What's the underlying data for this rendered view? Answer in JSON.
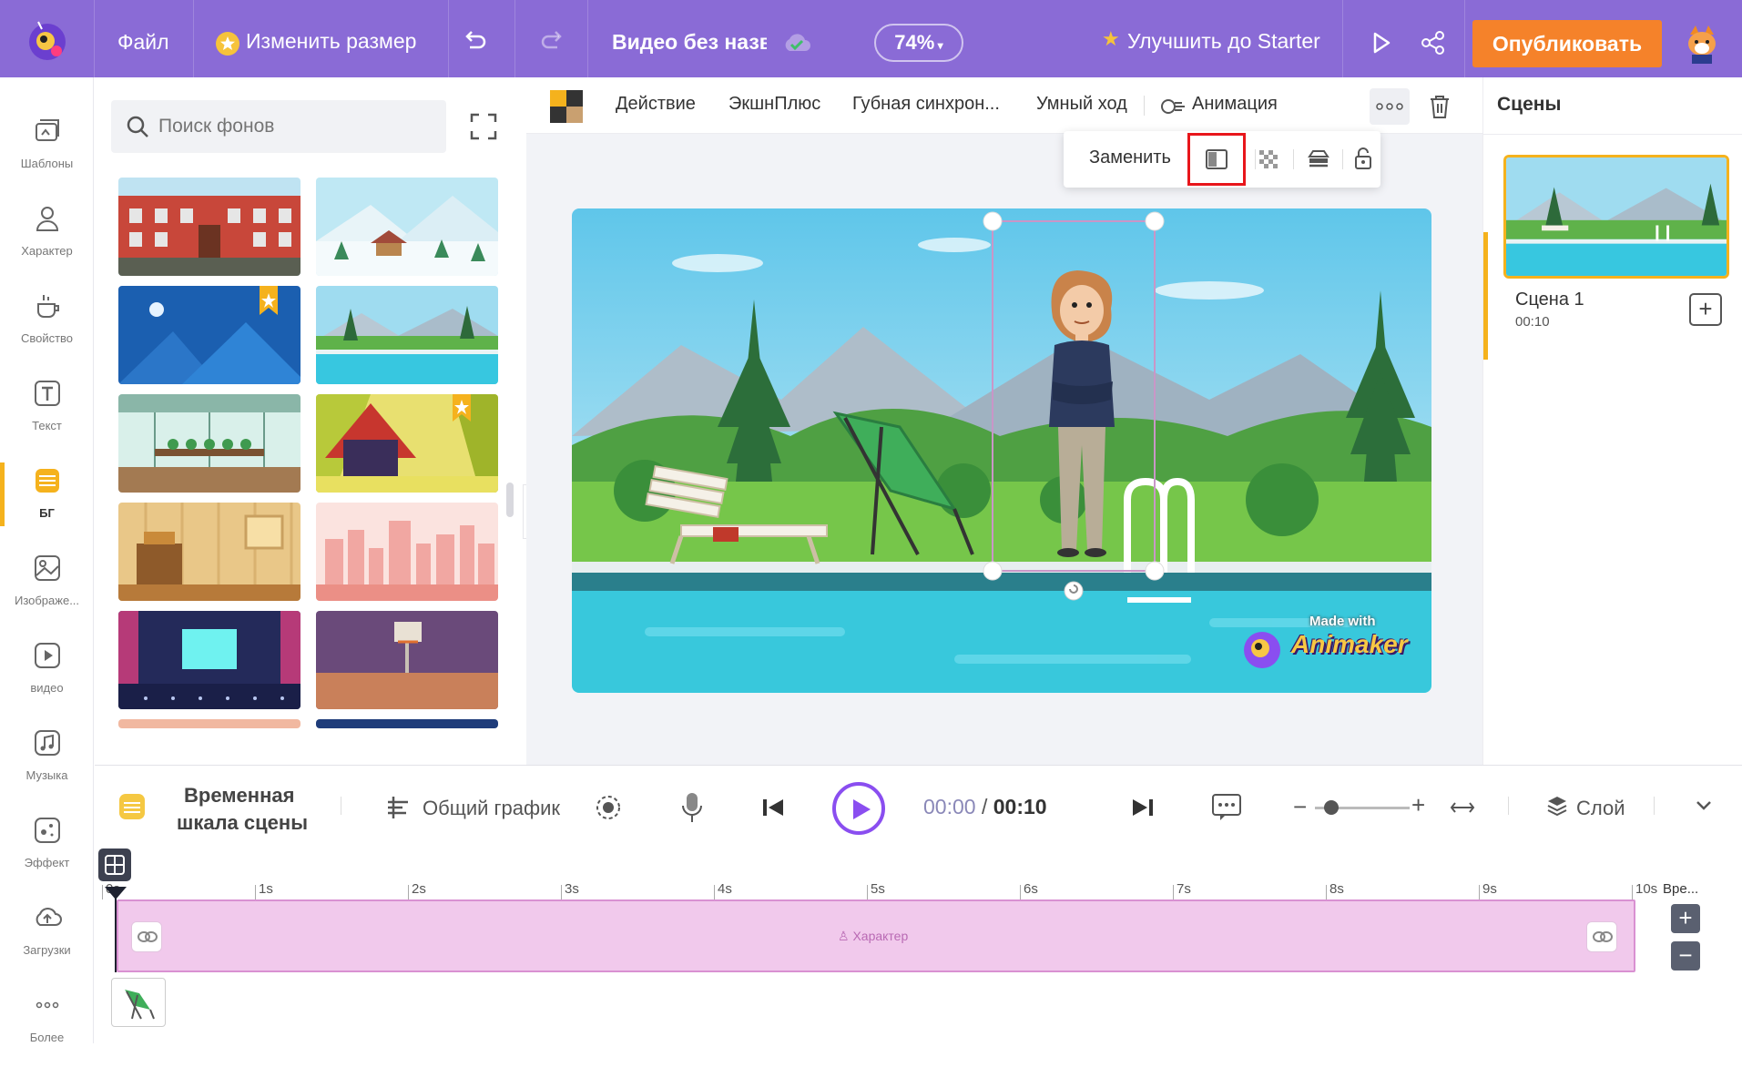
{
  "topbar": {
    "file_menu": "Файл",
    "resize_label": "Изменить размер",
    "video_title": "Видео без назв",
    "zoom": "74%",
    "upgrade_label": "Улучшить до Starter",
    "publish_label": "Опубликовать"
  },
  "rail": {
    "items": [
      {
        "label": "Шаблоны",
        "icon": "templates-icon"
      },
      {
        "label": "Характер",
        "icon": "character-icon"
      },
      {
        "label": "Свойство",
        "icon": "props-icon"
      },
      {
        "label": "Текст",
        "icon": "text-icon"
      },
      {
        "label": "БГ",
        "icon": "background-icon"
      },
      {
        "label": "Изображе...",
        "icon": "image-icon"
      },
      {
        "label": "видео",
        "icon": "video-icon"
      },
      {
        "label": "Музыка",
        "icon": "music-icon"
      },
      {
        "label": "Эффект",
        "icon": "effect-icon"
      },
      {
        "label": "Загрузки",
        "icon": "upload-icon"
      },
      {
        "label": "Более",
        "icon": "more-icon"
      }
    ]
  },
  "library": {
    "search_placeholder": "Поиск фонов"
  },
  "actbar": {
    "action": "Действие",
    "actionplus": "ЭкшнПлюс",
    "lipsync": "Губная синхрон...",
    "smart_move": "Умный ход",
    "animation": "Анимация"
  },
  "popup": {
    "replace": "Заменить"
  },
  "scene": {
    "watermark_top": "Made with",
    "watermark_brand": "Animaker"
  },
  "scenes_panel": {
    "title": "Сцены",
    "scene_name": "Сцена 1",
    "scene_duration": "00:10"
  },
  "timeline": {
    "title_line1": "Временная",
    "title_line2": "шкала сцены",
    "general_graph": "Общий график",
    "time_current": "00:00",
    "time_sep": " / ",
    "time_total": "00:10",
    "layer": "Слой",
    "ticks": [
      "0s",
      "1s",
      "2s",
      "3s",
      "4s",
      "5s",
      "6s",
      "7s",
      "8s",
      "9s",
      "10s"
    ],
    "time_col": "Вре...",
    "track_label": "Характер"
  },
  "colors": {
    "topbar": "#8a6bd6",
    "publish": "#f5822a",
    "accent": "#f5b21d",
    "play": "#8a4ef0",
    "highlight": "#e8161b",
    "track": "#f1c9ec"
  }
}
